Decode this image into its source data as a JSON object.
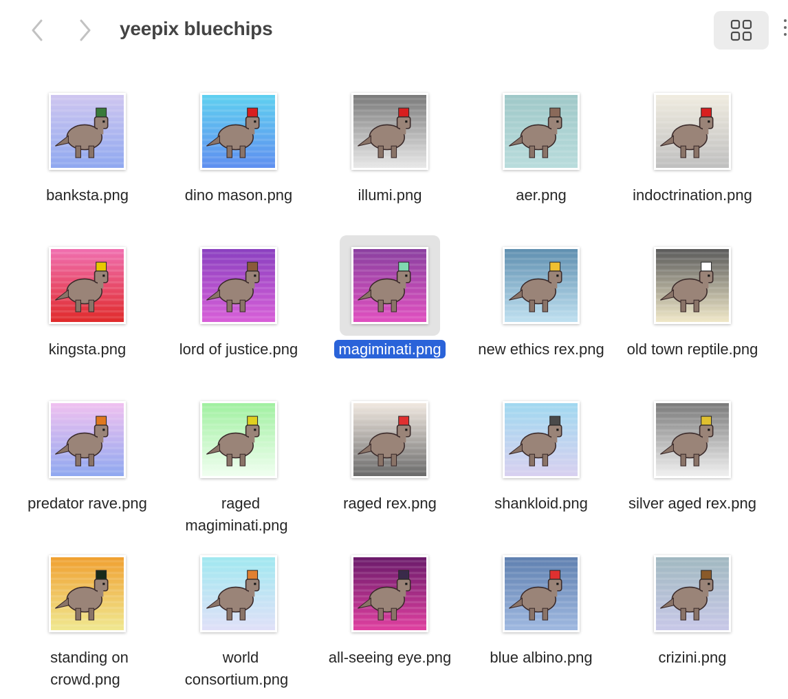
{
  "window": {
    "title": "yeepix bluechips"
  },
  "toolbar": {
    "back_icon": "chevron-left-icon",
    "forward_icon": "chevron-right-icon",
    "view_icon": "grid-view-icon",
    "more_icon": "more-vertical-icon"
  },
  "files": [
    {
      "name": "banksta.png",
      "bg": [
        "#cfc6f0",
        "#8fa8f0"
      ],
      "accent": "#3a7a3a",
      "selected": false
    },
    {
      "name": "dino mason.png",
      "bg": [
        "#5fd0f0",
        "#5f8ff0"
      ],
      "accent": "#d81f1f",
      "selected": false
    },
    {
      "name": "illumi.png",
      "bg": [
        "#7a7a7a",
        "#e8e8e8"
      ],
      "accent": "#d81f1f",
      "selected": false
    },
    {
      "name": "aer.png",
      "bg": [
        "#9fc8c8",
        "#b8dcdc"
      ],
      "accent": "#8a6a5a",
      "selected": false
    },
    {
      "name": "indoctrination.png",
      "bg": [
        "#f0ece0",
        "#bfbfbf"
      ],
      "accent": "#d81f1f",
      "selected": false
    },
    {
      "name": "kingsta.png",
      "bg": [
        "#f06fb0",
        "#e02a2a"
      ],
      "accent": "#e8c800",
      "selected": false
    },
    {
      "name": "lord of justice.png",
      "bg": [
        "#8a40c0",
        "#d85fd8"
      ],
      "accent": "#8a5a3a",
      "selected": false
    },
    {
      "name": "magiminati.png",
      "bg": [
        "#8a40a0",
        "#e050c0"
      ],
      "accent": "#80d8b0",
      "selected": true
    },
    {
      "name": "new ethics rex.png",
      "bg": [
        "#5f8fb0",
        "#bfe0f0"
      ],
      "accent": "#f0c030",
      "selected": false
    },
    {
      "name": "old town reptile.png",
      "bg": [
        "#5a5a5a",
        "#f0e8c8"
      ],
      "accent": "#ffffff",
      "selected": false
    },
    {
      "name": "predator rave.png",
      "bg": [
        "#f0c0f0",
        "#8fa8f0"
      ],
      "accent": "#e07820",
      "selected": false
    },
    {
      "name": "raged magiminati.png",
      "bg": [
        "#a0f0a0",
        "#f0fff0"
      ],
      "accent": "#e0d020",
      "selected": false
    },
    {
      "name": "raged rex.png",
      "bg": [
        "#f0e8e0",
        "#6a6a6a"
      ],
      "accent": "#e03030",
      "selected": false
    },
    {
      "name": "shankloid.png",
      "bg": [
        "#a0d8f0",
        "#d8d0f0"
      ],
      "accent": "#4a4a4a",
      "selected": false
    },
    {
      "name": "silver aged rex.png",
      "bg": [
        "#7a7a7a",
        "#f0f0f0"
      ],
      "accent": "#e0c030",
      "selected": false
    },
    {
      "name": "standing on crowd.png",
      "bg": [
        "#f0a030",
        "#f0e890"
      ],
      "accent": "#1a2a1a",
      "selected": false
    },
    {
      "name": "world consortium.png",
      "bg": [
        "#a0e8f0",
        "#e0e0f8"
      ],
      "accent": "#e08030",
      "selected": false
    },
    {
      "name": "all-seeing eye.png",
      "bg": [
        "#6a1a6a",
        "#e040a0"
      ],
      "accent": "#3a2a4a",
      "selected": false
    },
    {
      "name": "blue albino.png",
      "bg": [
        "#5f80b0",
        "#9fb8e0"
      ],
      "accent": "#e03030",
      "selected": false
    },
    {
      "name": "crizini.png",
      "bg": [
        "#a0b8c0",
        "#c8c8e8"
      ],
      "accent": "#8a5a2a",
      "selected": false
    }
  ]
}
